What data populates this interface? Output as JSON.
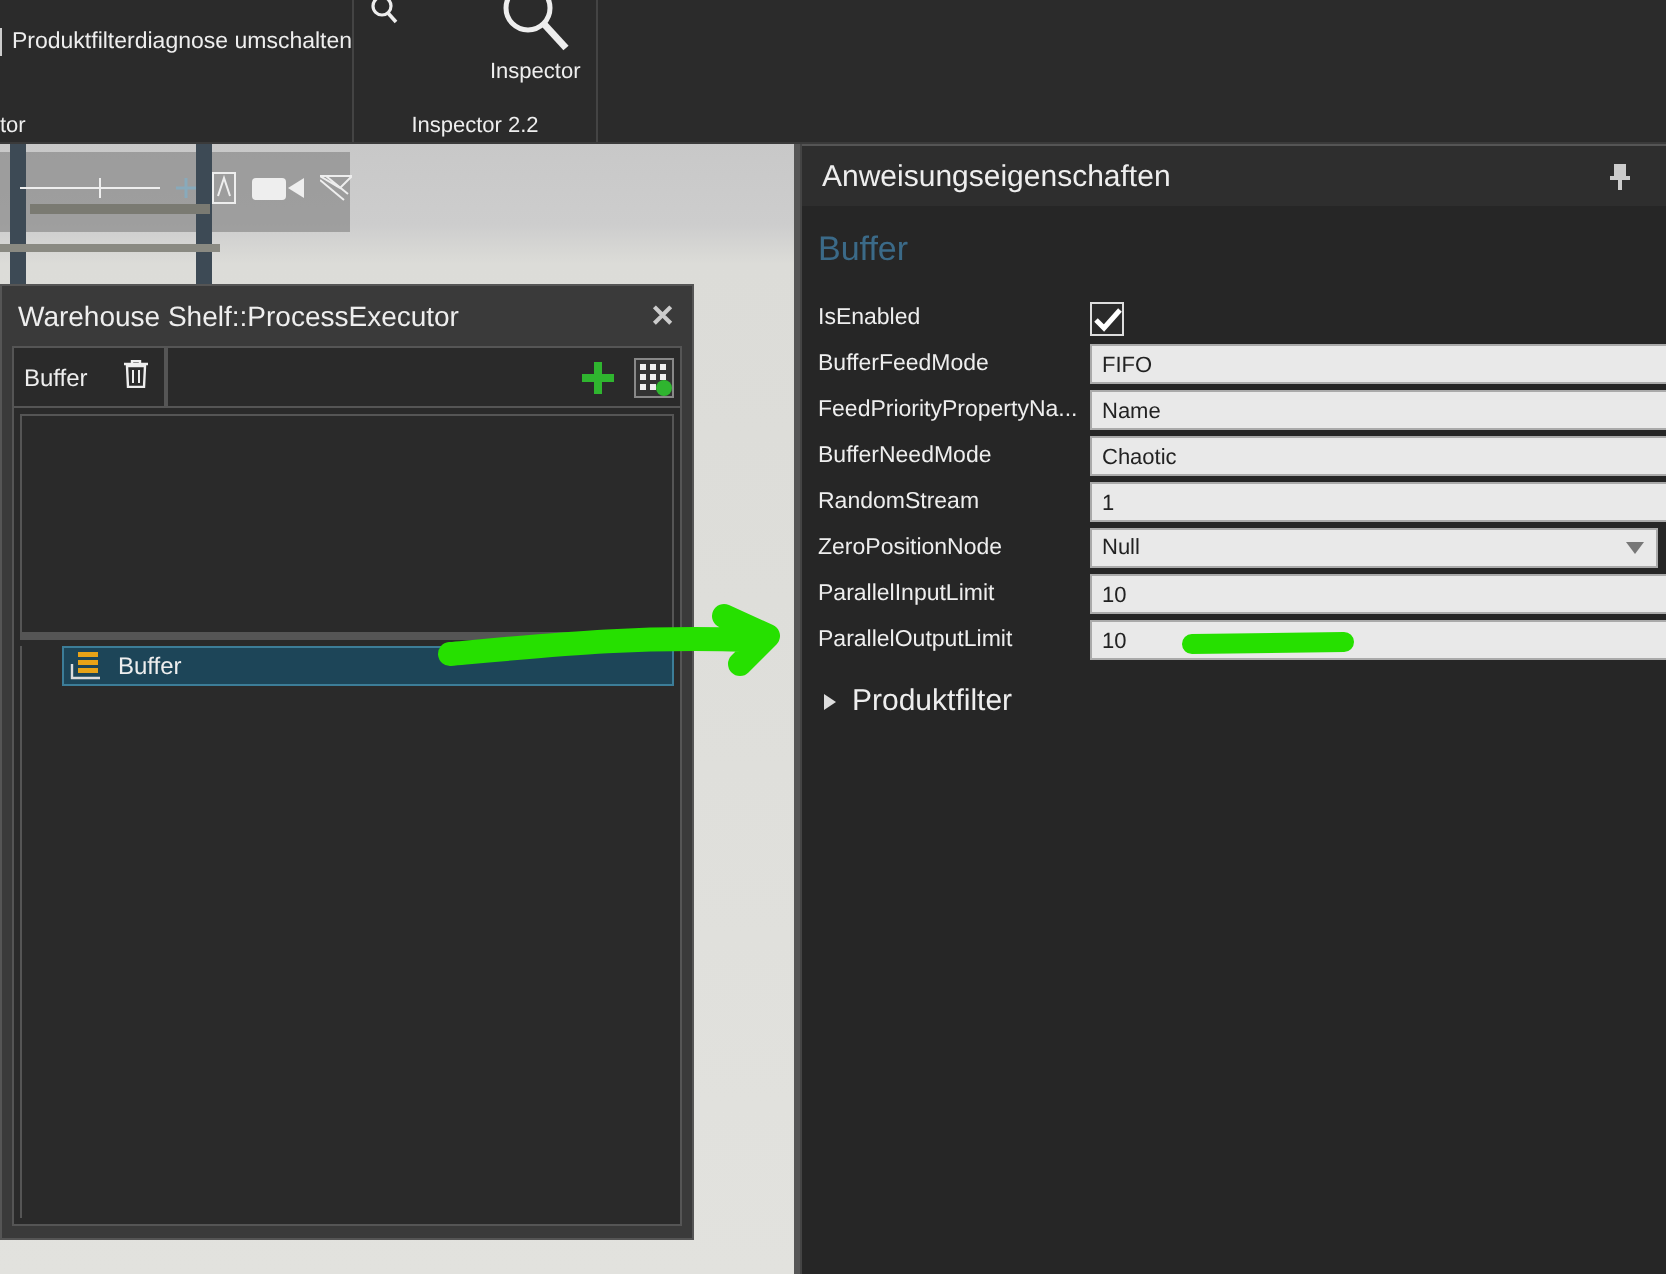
{
  "ribbon": {
    "items": [
      {
        "label": "Produktfilterdiagnose umschalten"
      }
    ],
    "group_label": "tor",
    "inspector_button": "Inspector",
    "inspector_group": "Inspector 2.2"
  },
  "process_window": {
    "title": "Warehouse Shelf::ProcessExecutor",
    "close": "✕",
    "tab": "Buffer",
    "tree_items": [
      {
        "label": "Buffer",
        "selected": true
      }
    ]
  },
  "properties": {
    "title": "Anweisungseigenschaften",
    "heading": "Buffer",
    "rows": [
      {
        "label": "IsEnabled",
        "kind": "checkbox",
        "checked": true
      },
      {
        "label": "BufferFeedMode",
        "kind": "text",
        "value": "FIFO"
      },
      {
        "label": "FeedPriorityPropertyNa...",
        "kind": "text",
        "value": "Name"
      },
      {
        "label": "BufferNeedMode",
        "kind": "text",
        "value": "Chaotic"
      },
      {
        "label": "RandomStream",
        "kind": "text",
        "value": "1"
      },
      {
        "label": "ZeroPositionNode",
        "kind": "dropdown",
        "value": "Null"
      },
      {
        "label": "ParallelInputLimit",
        "kind": "text",
        "value": "10"
      },
      {
        "label": "ParallelOutputLimit",
        "kind": "text",
        "value": "10"
      }
    ],
    "section": {
      "label": "Produktfilter",
      "expanded": false
    }
  }
}
